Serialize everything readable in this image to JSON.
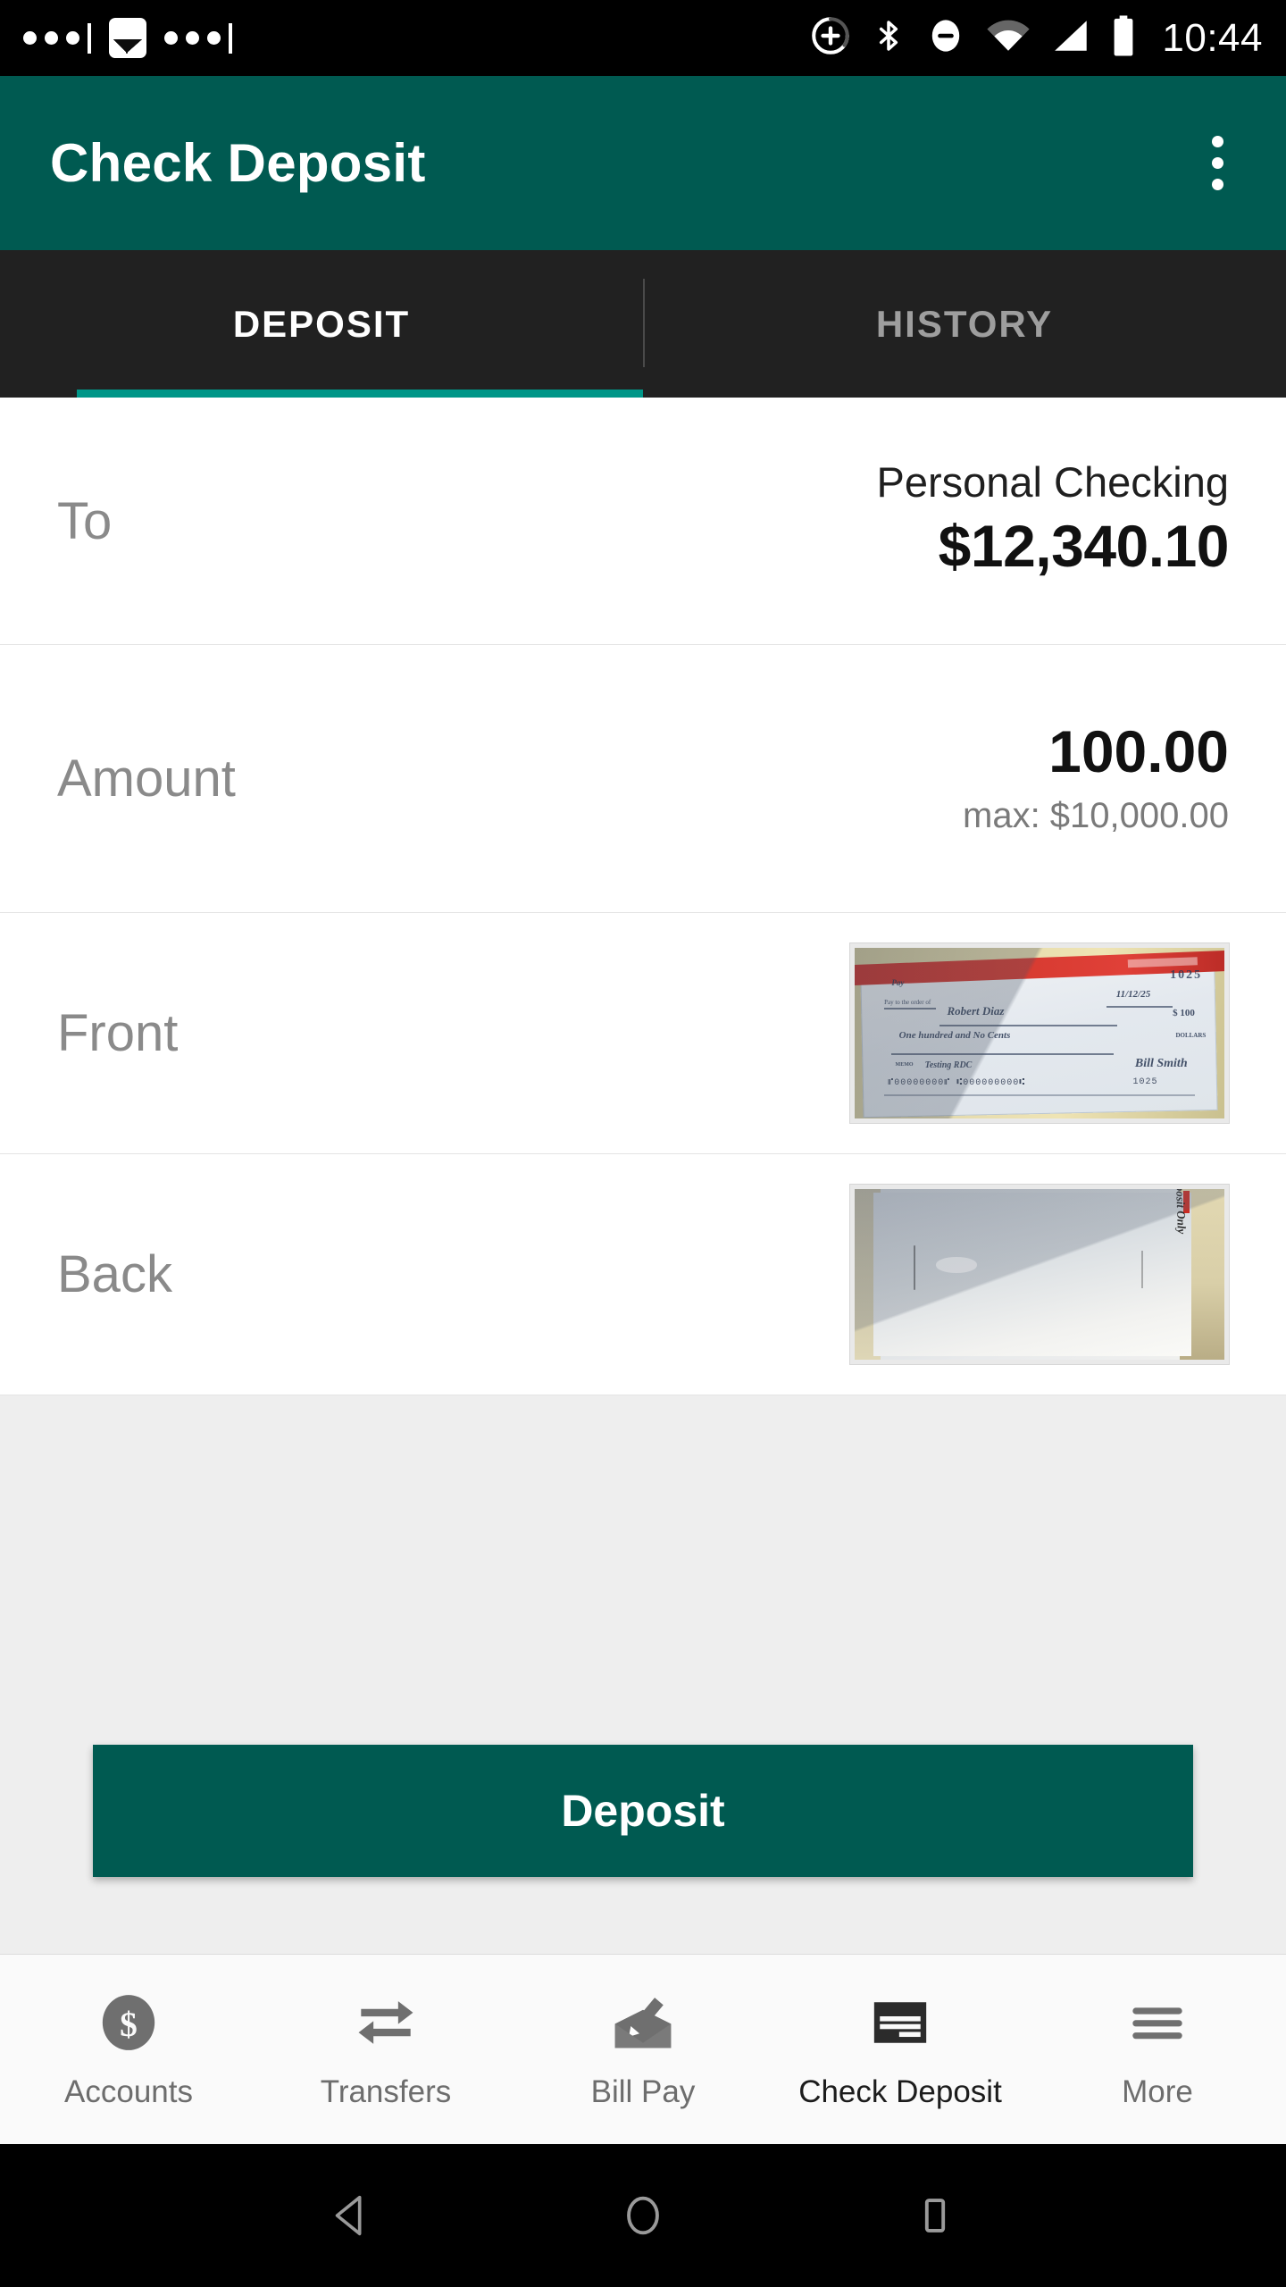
{
  "status_bar": {
    "time": "10:44",
    "left_icons": [
      "three-dots",
      "divider",
      "image-icon",
      "three-dots",
      "divider"
    ],
    "right_icons": [
      "add-circle-icon",
      "bluetooth-icon",
      "do-not-disturb-icon",
      "wifi-icon",
      "cell-signal-icon",
      "battery-icon"
    ]
  },
  "app_bar": {
    "title": "Check Deposit",
    "overflow_label": "More options"
  },
  "tabs": [
    {
      "label": "DEPOSIT",
      "active": true
    },
    {
      "label": "HISTORY",
      "active": false
    }
  ],
  "form": {
    "to": {
      "label": "To",
      "account_name": "Personal Checking",
      "balance": "$12,340.10"
    },
    "amount": {
      "label": "Amount",
      "value": "100.00",
      "max_hint": "max: $10,000.00"
    },
    "front": {
      "label": "Front",
      "image_alt": "front-of-check-photo",
      "check_number": "1025",
      "check_date": "11/12/2025",
      "payee": "Robert Diaz",
      "written_amount": "One hundred and No Cents",
      "numeric_amount": "$ 100.00",
      "memo": "Testing RDC",
      "signature": "Bill Smith",
      "micr": "⑈000000000⑈ ⑆00000000000⑆ 1025"
    },
    "back": {
      "label": "Back",
      "image_alt": "back-of-check-photo",
      "endorsement": "For Mobile Deposit Only"
    }
  },
  "primary_action": {
    "label": "Deposit"
  },
  "bottom_nav": [
    {
      "label": "Accounts",
      "icon": "dollar-circle-icon",
      "active": false
    },
    {
      "label": "Transfers",
      "icon": "transfer-arrows-icon",
      "active": false
    },
    {
      "label": "Bill Pay",
      "icon": "envelope-pen-icon",
      "active": false
    },
    {
      "label": "Check Deposit",
      "icon": "check-lines-icon",
      "active": true
    },
    {
      "label": "More",
      "icon": "hamburger-icon",
      "active": false
    }
  ],
  "android_nav": [
    {
      "label": "Back",
      "icon": "triangle-back-icon"
    },
    {
      "label": "Home",
      "icon": "circle-home-icon"
    },
    {
      "label": "Recents",
      "icon": "square-recents-icon"
    }
  ],
  "colors": {
    "brand_teal": "#005a51",
    "accent_teal": "#009688",
    "tab_bar": "#212121",
    "page_bg": "#eeeeee"
  }
}
